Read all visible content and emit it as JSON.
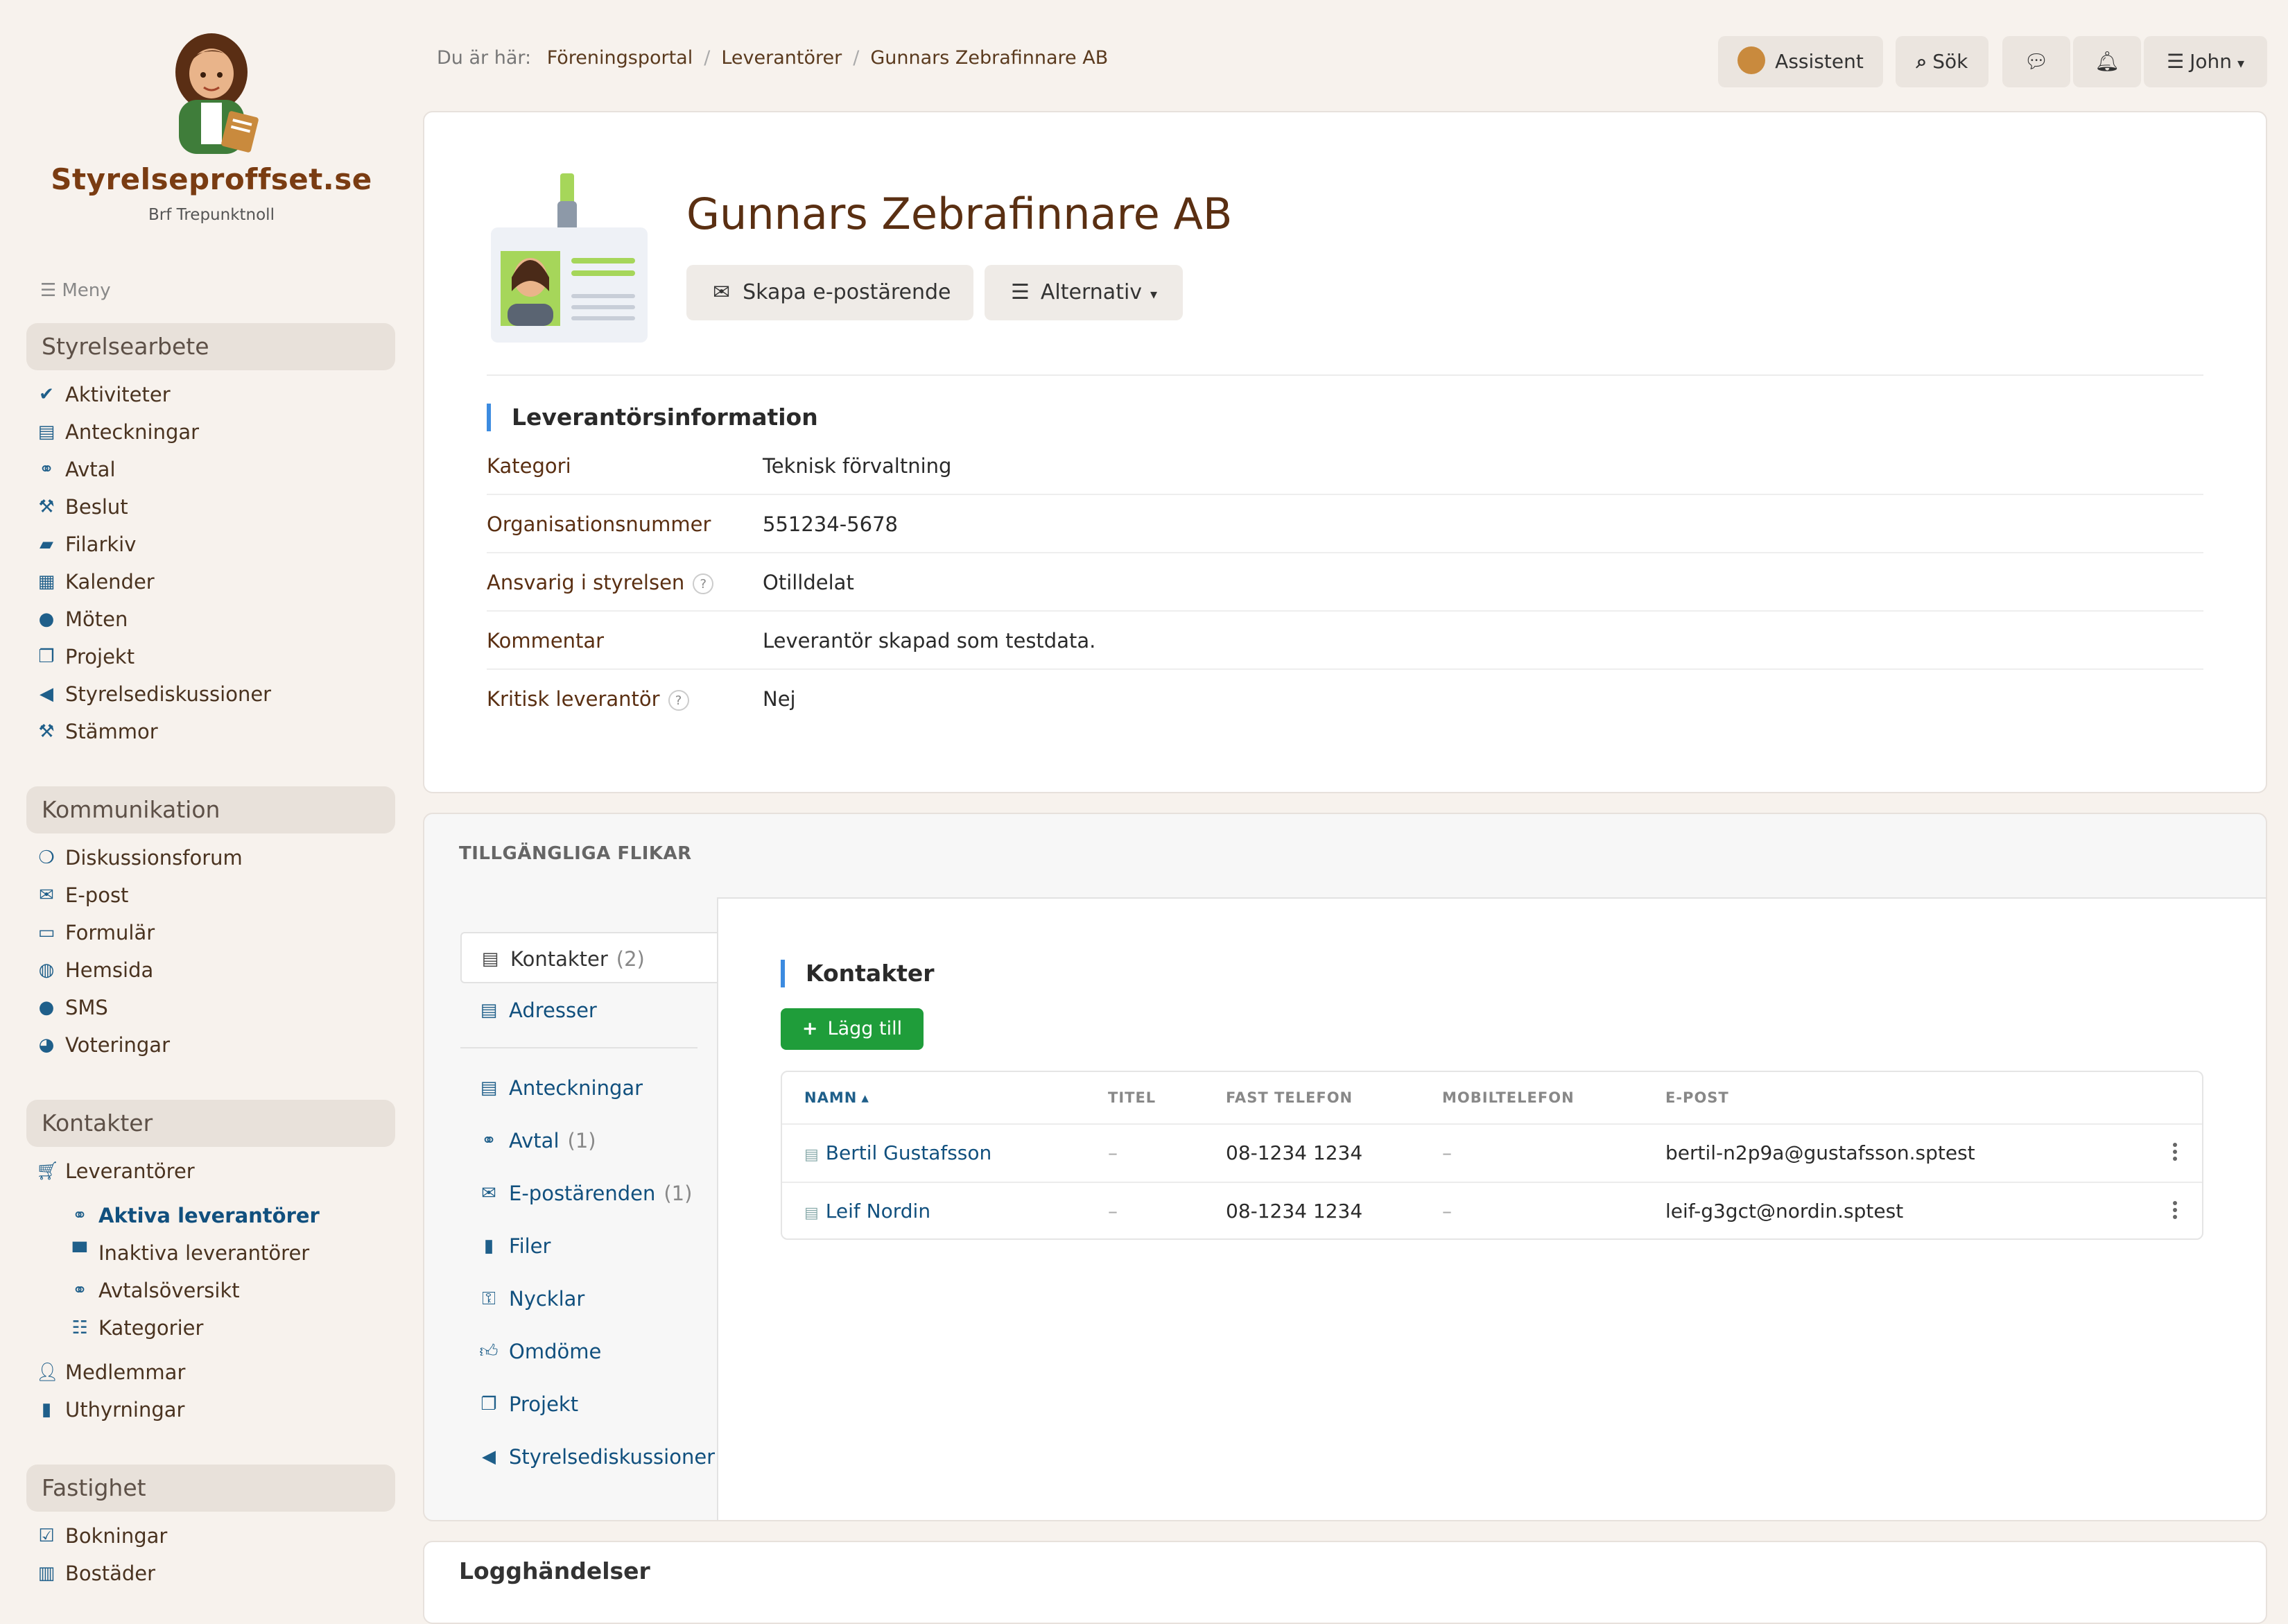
{
  "sidebar": {
    "brand_name": "Styrelseproffset.se",
    "brand_sub": "Brf Trepunktnoll",
    "menu_label": "Meny",
    "sections": [
      {
        "title": "Styrelsearbete",
        "items": [
          "Aktiviteter",
          "Anteckningar",
          "Avtal",
          "Beslut",
          "Filarkiv",
          "Kalender",
          "Möten",
          "Projekt",
          "Styrelsediskussioner",
          "Stämmor"
        ]
      },
      {
        "title": "Kommunikation",
        "items": [
          "Diskussionsforum",
          "E-post",
          "Formulär",
          "Hemsida",
          "SMS",
          "Voteringar"
        ]
      },
      {
        "title": "Kontakter",
        "items": [
          "Leverantörer",
          "Aktiva leverantörer",
          "Inaktiva leverantörer",
          "Avtalsöversikt",
          "Kategorier",
          "Medlemmar",
          "Uthyrningar"
        ]
      },
      {
        "title": "Fastighet",
        "items": [
          "Bokningar",
          "Bostäder"
        ]
      }
    ]
  },
  "topbar": {
    "breadcrumb_prefix": "Du är här:",
    "breadcrumb": [
      "Föreningsportal",
      "Leverantörer",
      "Gunnars Zebrafinnare AB"
    ],
    "assistant_label": "Assistent",
    "search_label": "Sök",
    "user_label": "John"
  },
  "supplier": {
    "name": "Gunnars Zebrafinnare AB",
    "email_button": "Skapa e-postärende",
    "options_button": "Alternativ",
    "info_title": "Leverantörsinformation",
    "info": [
      {
        "key": "Kategori",
        "value": "Teknisk förvaltning"
      },
      {
        "key": "Organisationsnummer",
        "value": "551234-5678"
      },
      {
        "key": "Ansvarig i styrelsen",
        "value": "Otilldelat"
      },
      {
        "key": "Kommentar",
        "value": "Leverantör skapad som testdata."
      },
      {
        "key": "Kritisk leverantör",
        "value": "Nej"
      }
    ],
    "help_mark": "?"
  },
  "tabs": {
    "heading": "TILLGÄNGLIGA FLIKAR",
    "items": [
      {
        "label": "Kontakter",
        "count": "(2)"
      },
      {
        "label": "Adresser",
        "count": ""
      },
      {
        "label": "Anteckningar",
        "count": ""
      },
      {
        "label": "Avtal",
        "count": "(1)"
      },
      {
        "label": "E-postärenden",
        "count": "(1)"
      },
      {
        "label": "Filer",
        "count": ""
      },
      {
        "label": "Nycklar",
        "count": ""
      },
      {
        "label": "Omdöme",
        "count": ""
      },
      {
        "label": "Projekt",
        "count": ""
      },
      {
        "label": "Styrelsediskussioner",
        "count": ""
      }
    ]
  },
  "contacts": {
    "title": "Kontakter",
    "add_button": "Lägg till",
    "columns": [
      "NAMN",
      "TITEL",
      "FAST TELEFON",
      "MOBILTELEFON",
      "E-POST"
    ],
    "sort_indicator": "▴",
    "rows": [
      {
        "name": "Bertil Gustafsson",
        "title": "–",
        "phone": "08-1234 1234",
        "mobile": "–",
        "email": "bertil-n2p9a@gustafsson.sptest"
      },
      {
        "name": "Leif Nordin",
        "title": "–",
        "phone": "08-1234 1234",
        "mobile": "–",
        "email": "leif-g3gct@nordin.sptest"
      }
    ]
  },
  "log": {
    "title": "Logghändelser"
  },
  "colors": {
    "brand": "#7a3c12",
    "link": "#11507e",
    "accent": "#3c8be0",
    "success": "#1f9d3a"
  }
}
